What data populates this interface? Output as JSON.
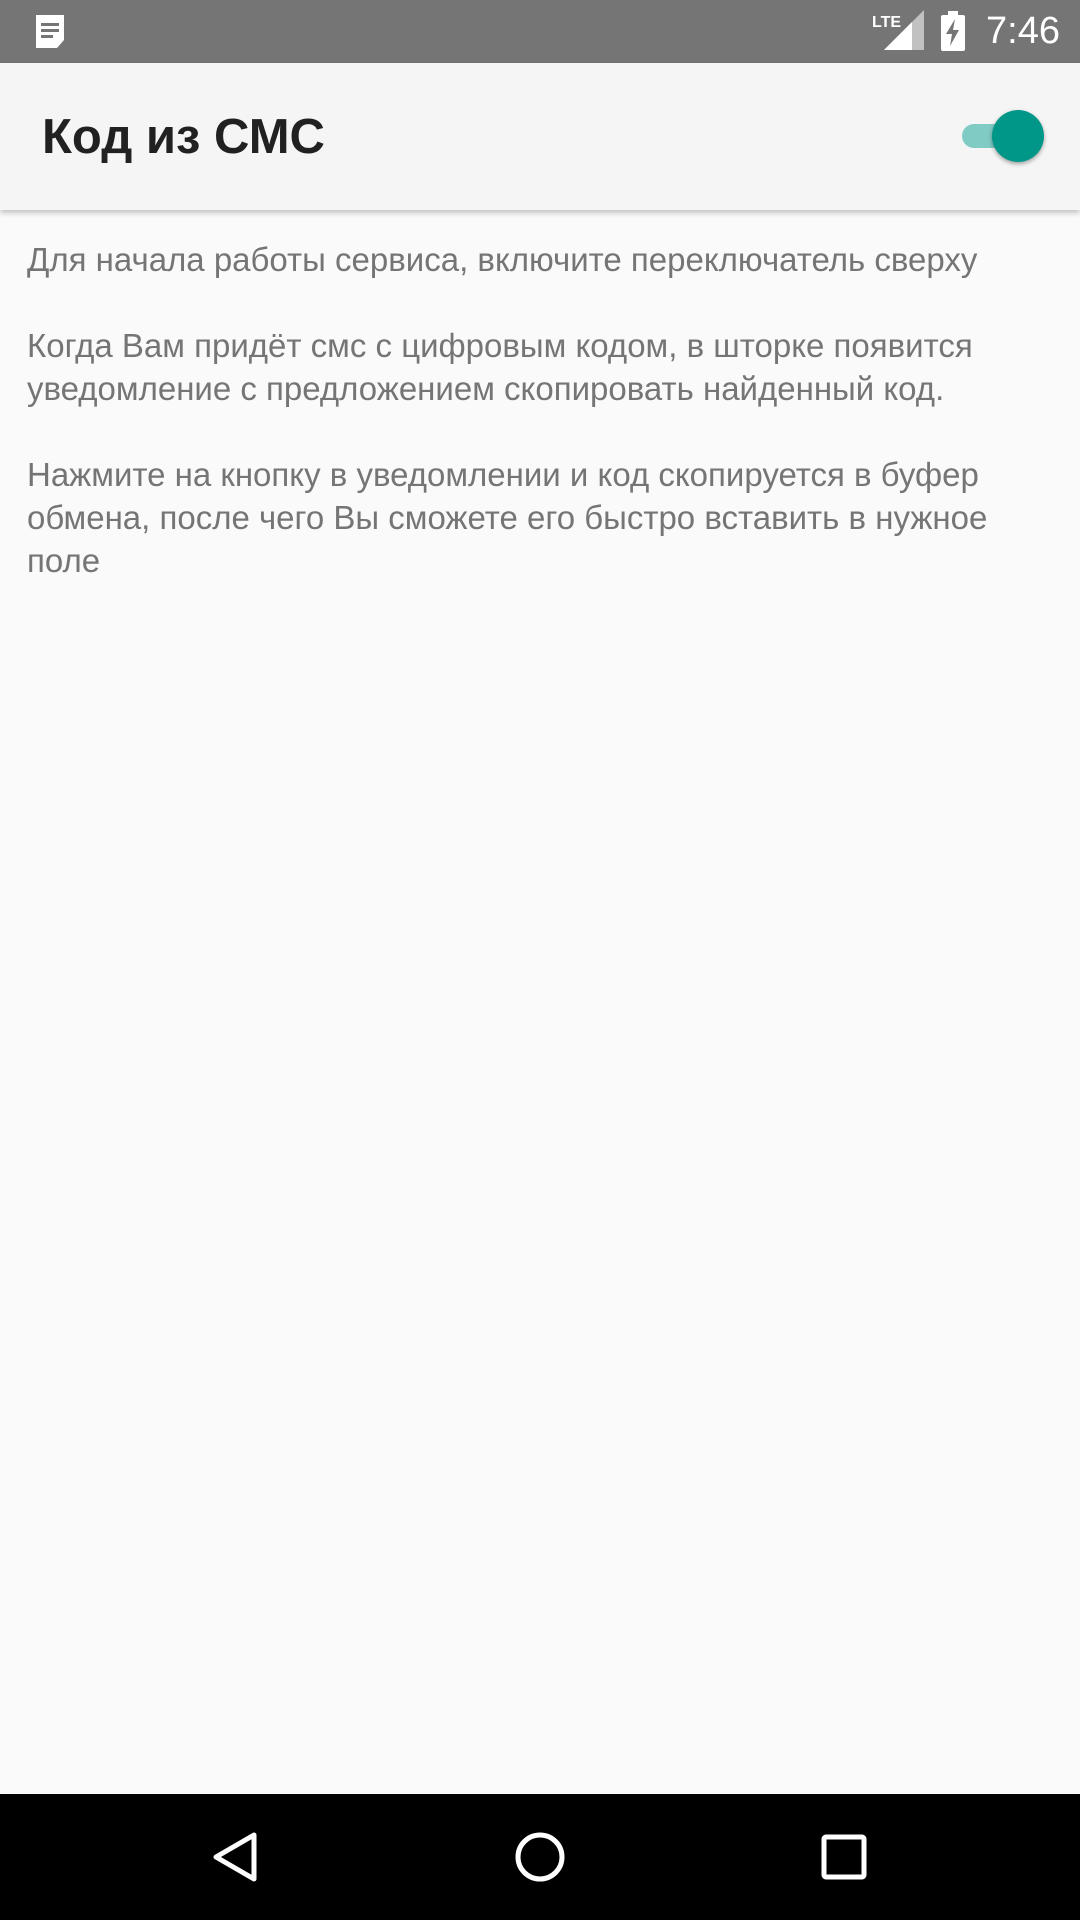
{
  "status_bar": {
    "network": "LTE",
    "time": "7:46",
    "icons": [
      "notification-icon",
      "lte-signal-icon",
      "battery-charging-icon"
    ]
  },
  "app_bar": {
    "title": "Код из СМС",
    "toggle_on": true
  },
  "content": {
    "paragraphs": [
      "Для начала работы сервиса, включите переключатель сверху",
      "Когда Вам придёт смс с цифровым кодом, в шторке появится уведомление с предложением скопировать найденный код.",
      "Нажмите на кнопку в уведомлении и код скопируется в буфер обмена, после чего Вы сможете его быстро вставить в нужное поле"
    ]
  },
  "nav_bar": {
    "icons": [
      "back-icon",
      "home-icon",
      "recent-apps-icon"
    ]
  },
  "colors": {
    "status_bar": "#757575",
    "app_bar": "#f5f5f5",
    "background": "#fafafa",
    "accent": "#009688",
    "accent_track": "#80cbc4",
    "body_text": "#757575",
    "title_text": "#212121"
  }
}
